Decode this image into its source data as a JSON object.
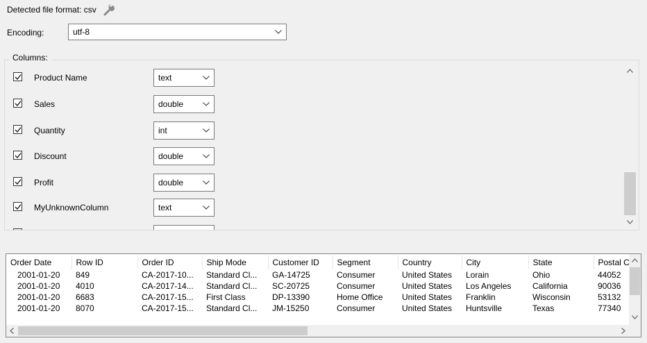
{
  "header": {
    "detected_label": "Detected file format: csv",
    "wrench_icon": "wrench-icon"
  },
  "encoding": {
    "label": "Encoding:",
    "value": "utf-8"
  },
  "columns": {
    "label": "Columns:",
    "items": [
      {
        "name": "Product Name",
        "type": "text",
        "checked": true
      },
      {
        "name": "Sales",
        "type": "double",
        "checked": true
      },
      {
        "name": "Quantity",
        "type": "int",
        "checked": true
      },
      {
        "name": "Discount",
        "type": "double",
        "checked": true
      },
      {
        "name": "Profit",
        "type": "double",
        "checked": true
      },
      {
        "name": "MyUnknownColumn",
        "type": "text",
        "checked": true
      },
      {
        "name": "",
        "type": "",
        "checked": false
      }
    ]
  },
  "preview": {
    "headers": [
      "Order Date",
      "Row ID",
      "Order ID",
      "Ship Mode",
      "Customer ID",
      "Segment",
      "Country",
      "City",
      "State",
      "Postal C"
    ],
    "rows": [
      [
        "2001-01-20",
        "849",
        "CA-2017-10...",
        "Standard Cl...",
        "GA-14725",
        "Consumer",
        "United States",
        "Lorain",
        "Ohio",
        "44052"
      ],
      [
        "2001-01-20",
        "4010",
        "CA-2017-14...",
        "Standard Cl...",
        "SC-20725",
        "Consumer",
        "United States",
        "Los Angeles",
        "California",
        "90036"
      ],
      [
        "2001-01-20",
        "6683",
        "CA-2017-15...",
        "First Class",
        "DP-13390",
        "Home Office",
        "United States",
        "Franklin",
        "Wisconsin",
        "53132"
      ],
      [
        "2001-01-20",
        "8070",
        "CA-2017-15...",
        "Standard Cl...",
        "JM-15250",
        "Consumer",
        "United States",
        "Huntsville",
        "Texas",
        "77340"
      ]
    ]
  }
}
